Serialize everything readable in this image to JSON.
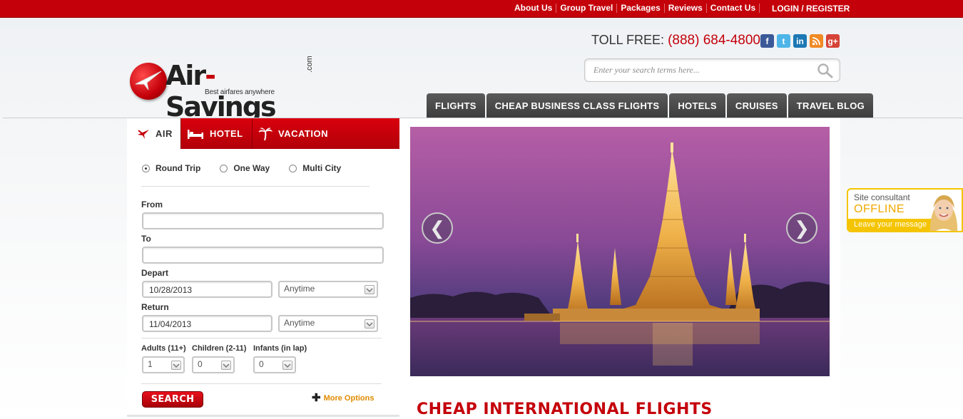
{
  "topnav": {
    "links": [
      "About Us",
      "Group Travel",
      "Packages",
      "Reviews",
      "Contact Us"
    ],
    "login": "LOGIN / REGISTER"
  },
  "header": {
    "logo_brand_left": "Air",
    "logo_brand_dash": "-",
    "logo_brand_right": "Savings",
    "logo_dotcom": ".com",
    "logo_tagline": "Best airfares anywhere",
    "toll_free_label": "TOLL FREE:",
    "toll_free_number": "(888) 684-4800",
    "social": [
      "facebook-icon",
      "twitter-icon",
      "linkedin-icon",
      "rss-icon",
      "google-plus-icon"
    ],
    "search_placeholder": "Enter your search terms here...",
    "nav": [
      "FLIGHTS",
      "CHEAP BUSINESS CLASS FLIGHTS",
      "HOTELS",
      "CRUISES",
      "TRAVEL BLOG"
    ]
  },
  "booking": {
    "tabs": [
      "AIR",
      "HOTEL",
      "VACATION"
    ],
    "trip_types": [
      "Round Trip",
      "One Way",
      "Multi City"
    ],
    "selected_trip_type": "Round Trip",
    "from_label": "From",
    "from_value": "",
    "to_label": "To",
    "to_value": "",
    "depart_label": "Depart",
    "depart_date": "10/28/2013",
    "depart_time": "Anytime",
    "return_label": "Return",
    "return_date": "11/04/2013",
    "return_time": "Anytime",
    "adults_label": "Adults (11+)",
    "adults_value": "1",
    "children_label": "Children (2-11)",
    "children_value": "0",
    "infants_label": "Infants (in lap)",
    "infants_value": "0",
    "search_button": "SEARCH",
    "more_options": "More Options"
  },
  "slider": {
    "prev": "❮",
    "next": "❯"
  },
  "main": {
    "heading": "CHEAP INTERNATIONAL FLIGHTS"
  },
  "consultant": {
    "title": "Site consultant",
    "status": "OFFLINE",
    "action": "Leave your message"
  },
  "colors": {
    "brand_red": "#c4000a",
    "nav_dark": "#444444",
    "consultant_yellow": "#f5c400"
  }
}
